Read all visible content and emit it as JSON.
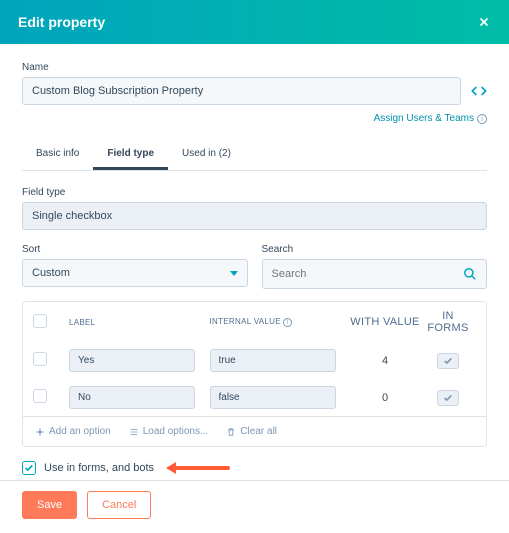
{
  "header": {
    "title": "Edit property"
  },
  "name": {
    "label": "Name",
    "value": "Custom Blog Subscription Property"
  },
  "assign": "Assign Users & Teams",
  "tabs": [
    {
      "label": "Basic info"
    },
    {
      "label": "Field type"
    },
    {
      "label": "Used in (2)"
    }
  ],
  "fieldType": {
    "label": "Field type",
    "value": "Single checkbox"
  },
  "sort": {
    "label": "Sort",
    "value": "Custom"
  },
  "search": {
    "label": "Search",
    "placeholder": "Search"
  },
  "tableHeaders": {
    "label": "LABEL",
    "internal": "INTERNAL VALUE",
    "withValue": "WITH VALUE",
    "inForms": "IN FORMS"
  },
  "options": [
    {
      "label": "Yes",
      "internal": "true",
      "withValue": "4"
    },
    {
      "label": "No",
      "internal": "false",
      "withValue": "0"
    }
  ],
  "actions": {
    "add": "Add an option",
    "load": "Load options...",
    "clear": "Clear all"
  },
  "useInForms": "Use in forms, and bots",
  "footer": {
    "save": "Save",
    "cancel": "Cancel"
  }
}
